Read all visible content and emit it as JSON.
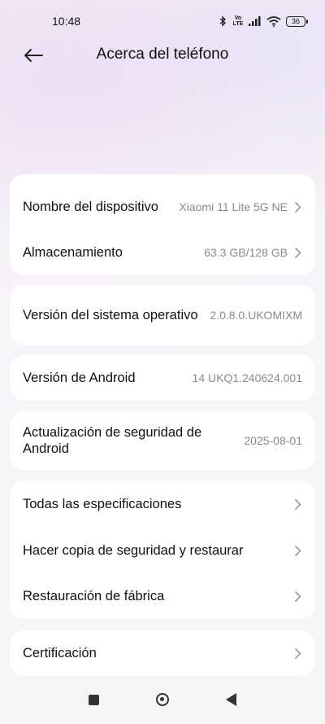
{
  "status_bar": {
    "time": "10:48",
    "network_label": "Vo LTE",
    "battery": "36",
    "icons": [
      "bluetooth-icon",
      "volte-icon",
      "signal-icon",
      "wifi-icon",
      "battery-icon"
    ]
  },
  "header": {
    "title": "Acerca del teléfono",
    "back_icon": "arrow-left-icon"
  },
  "cards": {
    "device": {
      "name_label": "Nombre del dispositivo",
      "name_value": "Xiaomi 11 Lite 5G NE",
      "storage_label": "Almacenamiento",
      "storage_value": "63.3 GB/128 GB"
    },
    "os": {
      "label": "Versión del sistema operativo",
      "value": "2.0.8.0.UKOMIXM"
    },
    "android": {
      "label": "Versión de Android",
      "value": "14 UKQ1.240624.001"
    },
    "security": {
      "label": "Actualización de seguridad de Android",
      "value": "2025-08-01"
    },
    "more": {
      "specs_label": "Todas las especificaciones",
      "backup_label": "Hacer copia de seguridad y restaurar",
      "factory_label": "Restauración de fábrica"
    },
    "cert": {
      "label": "Certificación"
    }
  },
  "nav_bar": {
    "icons": [
      "recents-square-icon",
      "home-circle-icon",
      "back-triangle-icon"
    ]
  }
}
